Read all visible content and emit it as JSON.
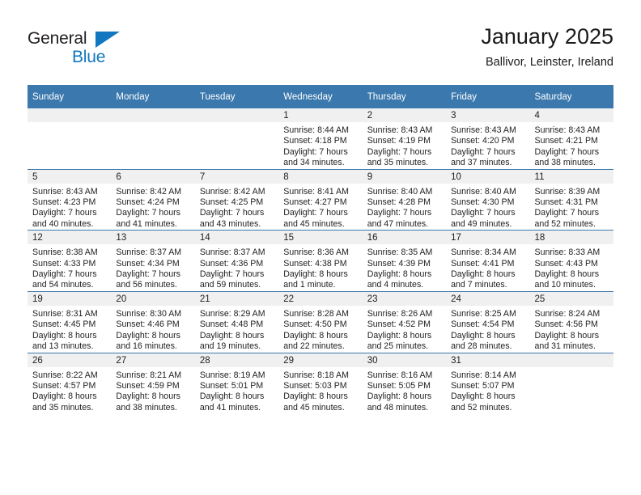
{
  "brand": {
    "name_part1": "General",
    "name_part2": "Blue",
    "accent_color": "#1277bf"
  },
  "header": {
    "title": "January 2025",
    "subtitle": "Ballivor, Leinster, Ireland"
  },
  "theme": {
    "header_blue": "#3b78ad",
    "daynum_band": "#f0f0f0"
  },
  "weekday_headers": [
    "Sunday",
    "Monday",
    "Tuesday",
    "Wednesday",
    "Thursday",
    "Friday",
    "Saturday"
  ],
  "labels": {
    "sunrise_prefix": "Sunrise:",
    "sunset_prefix": "Sunset:",
    "daylight_prefix": "Daylight:"
  },
  "weeks": [
    [
      {
        "day": "",
        "sunrise": "",
        "sunset": "",
        "daylight_line1": "",
        "daylight_line2": ""
      },
      {
        "day": "",
        "sunrise": "",
        "sunset": "",
        "daylight_line1": "",
        "daylight_line2": ""
      },
      {
        "day": "",
        "sunrise": "",
        "sunset": "",
        "daylight_line1": "",
        "daylight_line2": ""
      },
      {
        "day": "1",
        "sunrise": "Sunrise: 8:44 AM",
        "sunset": "Sunset: 4:18 PM",
        "daylight_line1": "Daylight: 7 hours",
        "daylight_line2": "and 34 minutes."
      },
      {
        "day": "2",
        "sunrise": "Sunrise: 8:43 AM",
        "sunset": "Sunset: 4:19 PM",
        "daylight_line1": "Daylight: 7 hours",
        "daylight_line2": "and 35 minutes."
      },
      {
        "day": "3",
        "sunrise": "Sunrise: 8:43 AM",
        "sunset": "Sunset: 4:20 PM",
        "daylight_line1": "Daylight: 7 hours",
        "daylight_line2": "and 37 minutes."
      },
      {
        "day": "4",
        "sunrise": "Sunrise: 8:43 AM",
        "sunset": "Sunset: 4:21 PM",
        "daylight_line1": "Daylight: 7 hours",
        "daylight_line2": "and 38 minutes."
      }
    ],
    [
      {
        "day": "5",
        "sunrise": "Sunrise: 8:43 AM",
        "sunset": "Sunset: 4:23 PM",
        "daylight_line1": "Daylight: 7 hours",
        "daylight_line2": "and 40 minutes."
      },
      {
        "day": "6",
        "sunrise": "Sunrise: 8:42 AM",
        "sunset": "Sunset: 4:24 PM",
        "daylight_line1": "Daylight: 7 hours",
        "daylight_line2": "and 41 minutes."
      },
      {
        "day": "7",
        "sunrise": "Sunrise: 8:42 AM",
        "sunset": "Sunset: 4:25 PM",
        "daylight_line1": "Daylight: 7 hours",
        "daylight_line2": "and 43 minutes."
      },
      {
        "day": "8",
        "sunrise": "Sunrise: 8:41 AM",
        "sunset": "Sunset: 4:27 PM",
        "daylight_line1": "Daylight: 7 hours",
        "daylight_line2": "and 45 minutes."
      },
      {
        "day": "9",
        "sunrise": "Sunrise: 8:40 AM",
        "sunset": "Sunset: 4:28 PM",
        "daylight_line1": "Daylight: 7 hours",
        "daylight_line2": "and 47 minutes."
      },
      {
        "day": "10",
        "sunrise": "Sunrise: 8:40 AM",
        "sunset": "Sunset: 4:30 PM",
        "daylight_line1": "Daylight: 7 hours",
        "daylight_line2": "and 49 minutes."
      },
      {
        "day": "11",
        "sunrise": "Sunrise: 8:39 AM",
        "sunset": "Sunset: 4:31 PM",
        "daylight_line1": "Daylight: 7 hours",
        "daylight_line2": "and 52 minutes."
      }
    ],
    [
      {
        "day": "12",
        "sunrise": "Sunrise: 8:38 AM",
        "sunset": "Sunset: 4:33 PM",
        "daylight_line1": "Daylight: 7 hours",
        "daylight_line2": "and 54 minutes."
      },
      {
        "day": "13",
        "sunrise": "Sunrise: 8:37 AM",
        "sunset": "Sunset: 4:34 PM",
        "daylight_line1": "Daylight: 7 hours",
        "daylight_line2": "and 56 minutes."
      },
      {
        "day": "14",
        "sunrise": "Sunrise: 8:37 AM",
        "sunset": "Sunset: 4:36 PM",
        "daylight_line1": "Daylight: 7 hours",
        "daylight_line2": "and 59 minutes."
      },
      {
        "day": "15",
        "sunrise": "Sunrise: 8:36 AM",
        "sunset": "Sunset: 4:38 PM",
        "daylight_line1": "Daylight: 8 hours",
        "daylight_line2": "and 1 minute."
      },
      {
        "day": "16",
        "sunrise": "Sunrise: 8:35 AM",
        "sunset": "Sunset: 4:39 PM",
        "daylight_line1": "Daylight: 8 hours",
        "daylight_line2": "and 4 minutes."
      },
      {
        "day": "17",
        "sunrise": "Sunrise: 8:34 AM",
        "sunset": "Sunset: 4:41 PM",
        "daylight_line1": "Daylight: 8 hours",
        "daylight_line2": "and 7 minutes."
      },
      {
        "day": "18",
        "sunrise": "Sunrise: 8:33 AM",
        "sunset": "Sunset: 4:43 PM",
        "daylight_line1": "Daylight: 8 hours",
        "daylight_line2": "and 10 minutes."
      }
    ],
    [
      {
        "day": "19",
        "sunrise": "Sunrise: 8:31 AM",
        "sunset": "Sunset: 4:45 PM",
        "daylight_line1": "Daylight: 8 hours",
        "daylight_line2": "and 13 minutes."
      },
      {
        "day": "20",
        "sunrise": "Sunrise: 8:30 AM",
        "sunset": "Sunset: 4:46 PM",
        "daylight_line1": "Daylight: 8 hours",
        "daylight_line2": "and 16 minutes."
      },
      {
        "day": "21",
        "sunrise": "Sunrise: 8:29 AM",
        "sunset": "Sunset: 4:48 PM",
        "daylight_line1": "Daylight: 8 hours",
        "daylight_line2": "and 19 minutes."
      },
      {
        "day": "22",
        "sunrise": "Sunrise: 8:28 AM",
        "sunset": "Sunset: 4:50 PM",
        "daylight_line1": "Daylight: 8 hours",
        "daylight_line2": "and 22 minutes."
      },
      {
        "day": "23",
        "sunrise": "Sunrise: 8:26 AM",
        "sunset": "Sunset: 4:52 PM",
        "daylight_line1": "Daylight: 8 hours",
        "daylight_line2": "and 25 minutes."
      },
      {
        "day": "24",
        "sunrise": "Sunrise: 8:25 AM",
        "sunset": "Sunset: 4:54 PM",
        "daylight_line1": "Daylight: 8 hours",
        "daylight_line2": "and 28 minutes."
      },
      {
        "day": "25",
        "sunrise": "Sunrise: 8:24 AM",
        "sunset": "Sunset: 4:56 PM",
        "daylight_line1": "Daylight: 8 hours",
        "daylight_line2": "and 31 minutes."
      }
    ],
    [
      {
        "day": "26",
        "sunrise": "Sunrise: 8:22 AM",
        "sunset": "Sunset: 4:57 PM",
        "daylight_line1": "Daylight: 8 hours",
        "daylight_line2": "and 35 minutes."
      },
      {
        "day": "27",
        "sunrise": "Sunrise: 8:21 AM",
        "sunset": "Sunset: 4:59 PM",
        "daylight_line1": "Daylight: 8 hours",
        "daylight_line2": "and 38 minutes."
      },
      {
        "day": "28",
        "sunrise": "Sunrise: 8:19 AM",
        "sunset": "Sunset: 5:01 PM",
        "daylight_line1": "Daylight: 8 hours",
        "daylight_line2": "and 41 minutes."
      },
      {
        "day": "29",
        "sunrise": "Sunrise: 8:18 AM",
        "sunset": "Sunset: 5:03 PM",
        "daylight_line1": "Daylight: 8 hours",
        "daylight_line2": "and 45 minutes."
      },
      {
        "day": "30",
        "sunrise": "Sunrise: 8:16 AM",
        "sunset": "Sunset: 5:05 PM",
        "daylight_line1": "Daylight: 8 hours",
        "daylight_line2": "and 48 minutes."
      },
      {
        "day": "31",
        "sunrise": "Sunrise: 8:14 AM",
        "sunset": "Sunset: 5:07 PM",
        "daylight_line1": "Daylight: 8 hours",
        "daylight_line2": "and 52 minutes."
      },
      {
        "day": "",
        "sunrise": "",
        "sunset": "",
        "daylight_line1": "",
        "daylight_line2": ""
      }
    ]
  ]
}
